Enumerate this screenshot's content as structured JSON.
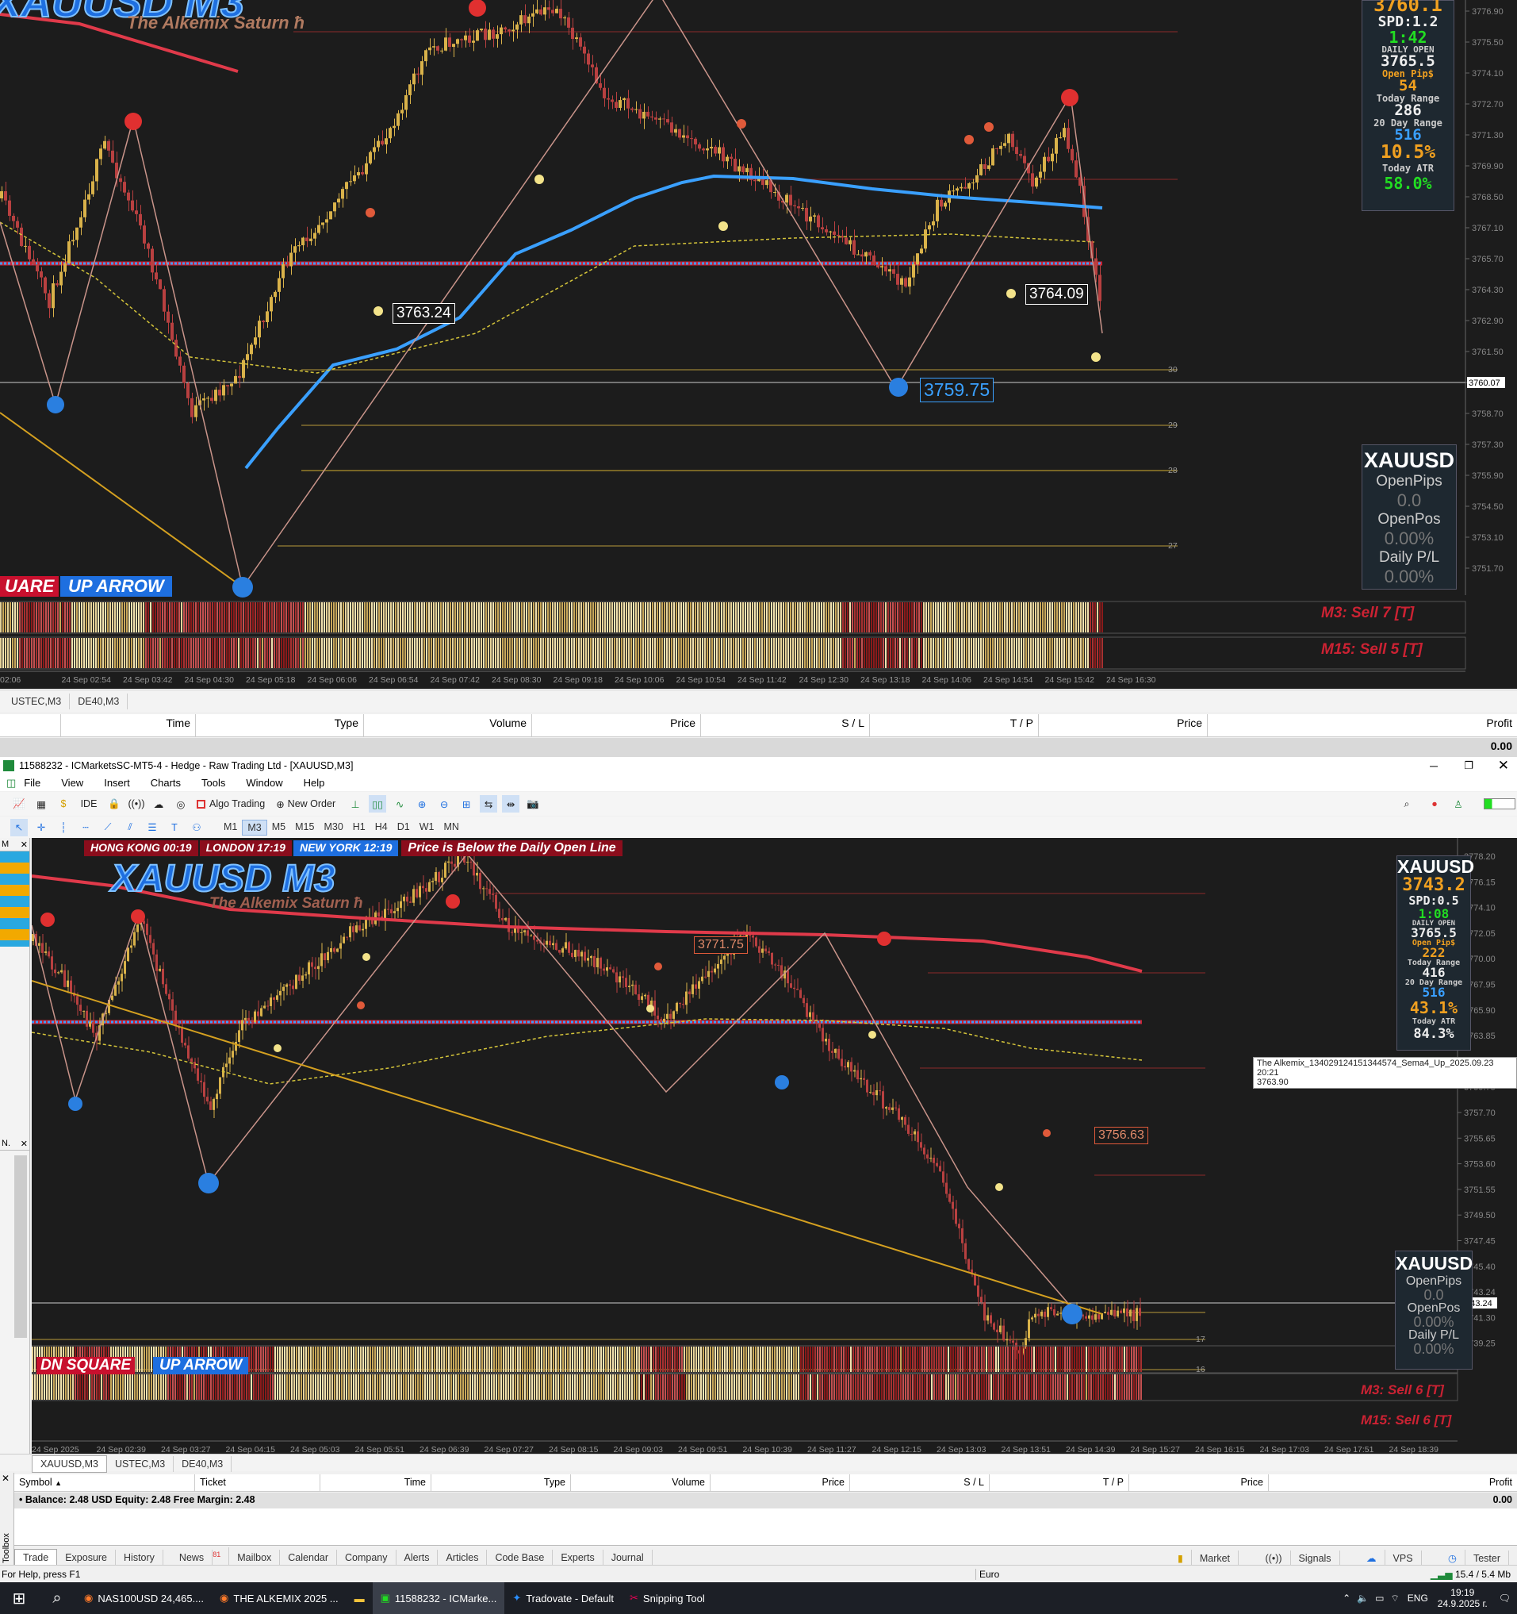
{
  "top_chart": {
    "title": "XAUUSD M3",
    "subtitle": "The Alkemix Saturn ħ",
    "prices": [
      "3776.90",
      "3775.50",
      "3774.10",
      "3772.70",
      "3771.30",
      "3769.90",
      "3768.50",
      "3767.10",
      "3765.70",
      "3764.30",
      "3762.90",
      "3761.50",
      "3760.07",
      "3758.70",
      "3757.30",
      "3755.90",
      "3754.50",
      "3753.10",
      "3751.70"
    ],
    "current_price": "3760.07",
    "times": [
      "02:06",
      "24 Sep 02:54",
      "24 Sep 03:42",
      "24 Sep 04:30",
      "24 Sep 05:18",
      "24 Sep 06:06",
      "24 Sep 06:54",
      "24 Sep 07:42",
      "24 Sep 08:30",
      "24 Sep 09:18",
      "24 Sep 10:06",
      "24 Sep 10:54",
      "24 Sep 11:42",
      "24 Sep 12:30",
      "24 Sep 13:18",
      "24 Sep 14:06",
      "24 Sep 14:54",
      "24 Sep 15:42",
      "24 Sep 16:30"
    ],
    "price_labels": {
      "a": "3763.24",
      "b": "3764.09",
      "c": "3759.75"
    },
    "info": {
      "bid": "3760.1",
      "spread": "SPD:1.2",
      "timer": "1:42",
      "daily_open_label": "DAILY OPEN",
      "daily_open": "3765.5",
      "open_pips_label": "Open Pip$",
      "open_pips": "54",
      "today_range_label": "Today Range",
      "today_range": "286",
      "day20_label": "20 Day Range",
      "day20": "516",
      "pct1": "10.5%",
      "atr_label": "Today ATR",
      "atr": "58.0%"
    },
    "panel": {
      "symbol": "XAUUSD",
      "openpips_label": "OpenPips",
      "openpips": "0.0",
      "openpos_label": "OpenPos",
      "openpos": "0.00%",
      "daily_label": "Daily P/L",
      "daily": "0.00%"
    },
    "badges": {
      "left": "UARE",
      "right": "UP ARROW"
    },
    "sig_m3": "M3: Sell 7 [T]",
    "sig_m15": "M15: Sell 5 [T]",
    "level_nums": [
      "30",
      "29",
      "28",
      "27"
    ],
    "tabs": [
      "USTEC,M3",
      "DE40,M3"
    ]
  },
  "top_table": {
    "headers": [
      "Time",
      "Type",
      "Volume",
      "Price",
      "S / L",
      "T / P",
      "Price",
      "Profit"
    ],
    "profit": "0.00"
  },
  "window": {
    "title": "11588232 - ICMarketsSC-MT5-4 - Hedge - Raw Trading Ltd - [XAUUSD,M3]",
    "menu": [
      "File",
      "View",
      "Insert",
      "Charts",
      "Tools",
      "Window",
      "Help"
    ],
    "toolbar": {
      "ide": "IDE",
      "algo": "Algo Trading",
      "new_order": "New Order"
    },
    "timeframes": [
      "M1",
      "M3",
      "M5",
      "M15",
      "M30",
      "H1",
      "H4",
      "D1",
      "W1",
      "MN"
    ],
    "active_tf": "M3"
  },
  "bottom_chart": {
    "title": "XAUUSD M3",
    "subtitle": "The Alkemix Saturn ħ",
    "sessions": [
      "HONG KONG 00:19",
      "LONDON 17:19",
      "NEW YORK 12:19"
    ],
    "session_msg": "Price is Below the Daily Open Line",
    "prices": [
      "3778.20",
      "3776.15",
      "3774.10",
      "3772.05",
      "3770.00",
      "3767.95",
      "3765.90",
      "3763.85",
      "3761.80",
      "3759.75",
      "3757.70",
      "3755.65",
      "3753.60",
      "3751.55",
      "3749.50",
      "3747.45",
      "3745.40",
      "3743.24",
      "3741.30",
      "3739.25"
    ],
    "current_price": "3743.24",
    "times": [
      "24 Sep 2025",
      "24 Sep 02:39",
      "24 Sep 03:27",
      "24 Sep 04:15",
      "24 Sep 05:03",
      "24 Sep 05:51",
      "24 Sep 06:39",
      "24 Sep 07:27",
      "24 Sep 08:15",
      "24 Sep 09:03",
      "24 Sep 09:51",
      "24 Sep 10:39",
      "24 Sep 11:27",
      "24 Sep 12:15",
      "24 Sep 13:03",
      "24 Sep 13:51",
      "24 Sep 14:39",
      "24 Sep 15:27",
      "24 Sep 16:15",
      "24 Sep 17:03",
      "24 Sep 17:51",
      "24 Sep 18:39"
    ],
    "price_labels": {
      "a": "3771.75",
      "b": "3756.63"
    },
    "tooltip": {
      "line1": "The Alkemix_134029124151344574_Sema4_Up_2025.09.23 20:21",
      "line2": "3763.90"
    },
    "info": {
      "symbol": "XAUUSD",
      "bid": "3743.2",
      "spread": "SPD:0.5",
      "timer": "1:08",
      "daily_open_label": "DAILY OPEN",
      "daily_open": "3765.5",
      "open_pips_label": "Open Pip$",
      "open_pips": "222",
      "today_range_label": "Today Range",
      "today_range": "416",
      "day20_label": "20 Day Range",
      "day20": "516",
      "pct1": "43.1%",
      "atr_label": "Today ATR",
      "atr": "84.3%"
    },
    "panel": {
      "symbol": "XAUUSD",
      "openpips_label": "OpenPips",
      "openpips": "0.0",
      "openpos_label": "OpenPos",
      "openpos": "0.00%",
      "daily_label": "Daily P/L",
      "daily": "0.00%"
    },
    "badges": {
      "left": "DN SQUARE",
      "right": "UP ARROW"
    },
    "sig_m3": "M3: Sell 6 [T]",
    "sig_m15": "M15: Sell 6 [T]",
    "level_nums": [
      "17",
      "16"
    ],
    "tabs": [
      "XAUUSD,M3",
      "USTEC,M3",
      "DE40,M3"
    ]
  },
  "navigator": {
    "m_label": "M",
    "n_label": "N."
  },
  "bottom_table": {
    "headers": [
      "Symbol",
      "Ticket",
      "Time",
      "Type",
      "Volume",
      "Price",
      "S / L",
      "T / P",
      "Price",
      "Profit"
    ],
    "balance": "Balance: 2.48 USD  Equity: 2.48  Free Margin: 2.48",
    "profit": "0.00"
  },
  "toolbox_label": "Toolbox",
  "tool_tabs": [
    "Trade",
    "Exposure",
    "History",
    "News",
    "Mailbox",
    "Calendar",
    "Company",
    "Alerts",
    "Articles",
    "Code Base",
    "Experts",
    "Journal"
  ],
  "news_badge": "81",
  "right_tools": [
    "Market",
    "Signals",
    "VPS",
    "Tester"
  ],
  "status": {
    "help": "For Help, press F1",
    "profile": "Euro",
    "net": "15.4 / 5.4 Mb"
  },
  "taskbar": {
    "apps": [
      "NAS100USD 24,465....",
      "THE ALKEMIX 2025 ...",
      "11588232 - ICMarke...",
      "Tradovate - Default",
      "Snipping Tool"
    ],
    "lang": "ENG",
    "time": "19:19",
    "date": "24.9.2025 г."
  },
  "colors": {
    "bull": "#d9b24a",
    "bear": "#b84040",
    "ma_blue": "#3aa0ff",
    "daily_open": "#cc2233",
    "accent": "#2a7fe0"
  }
}
